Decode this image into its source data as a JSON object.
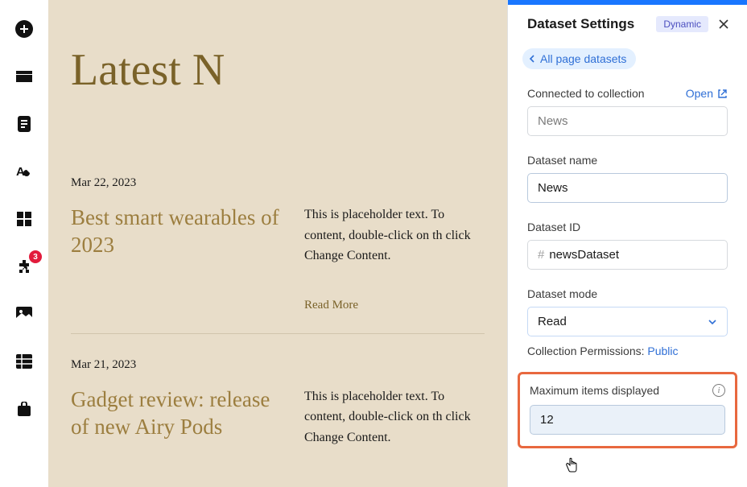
{
  "sidebar": {
    "badge_count": "3"
  },
  "canvas": {
    "heading": "Latest N",
    "articles": [
      {
        "date": "Mar 22, 2023",
        "title": "Best smart wearables of 2023",
        "body": "This is placeholder text. To content, double-click on th click Change Content.",
        "read_more": "Read More"
      },
      {
        "date": "Mar 21, 2023",
        "title": "Gadget review: release of new Airy Pods",
        "body": "This is placeholder text. To content, double-click on th click Change Content."
      }
    ]
  },
  "panel": {
    "title": "Dataset Settings",
    "pill": "Dynamic",
    "breadcrumb": "All page datasets",
    "connected_label": "Connected to collection",
    "open_label": "Open",
    "collection_value": "News",
    "name_label": "Dataset name",
    "name_value": "News",
    "id_label": "Dataset ID",
    "id_value": "newsDataset",
    "mode_label": "Dataset mode",
    "mode_value": "Read",
    "perm_label": "Collection Permissions: ",
    "perm_value": "Public",
    "max_label": "Maximum items displayed",
    "max_value": "12"
  }
}
